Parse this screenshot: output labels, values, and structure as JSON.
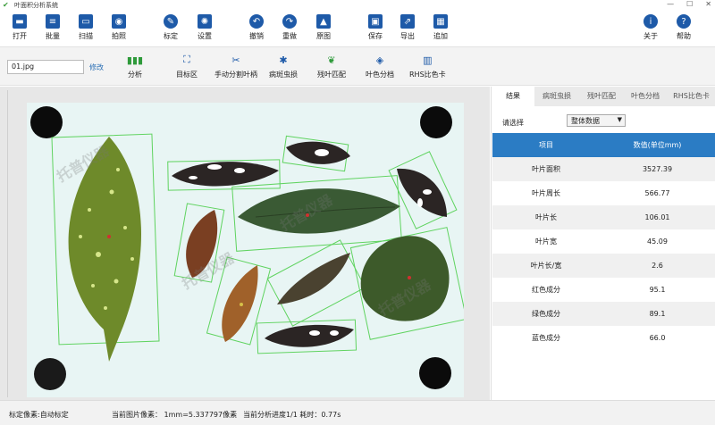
{
  "window": {
    "title": "叶面积分析系统"
  },
  "toolbar": [
    {
      "label": "打开",
      "icon": "folder-open-icon",
      "color": "#1e5aa8"
    },
    {
      "label": "批量",
      "icon": "batch-icon",
      "color": "#1e5aa8"
    },
    {
      "label": "扫描",
      "icon": "scanner-icon",
      "color": "#1e5aa8"
    },
    {
      "label": "拍照",
      "icon": "camera-icon",
      "color": "#1e5aa8"
    },
    {
      "label": "标定",
      "icon": "calibrate-icon",
      "color": "#1e5aa8"
    },
    {
      "label": "设置",
      "icon": "gear-icon",
      "color": "#1e5aa8"
    },
    {
      "label": "撤销",
      "icon": "undo-icon",
      "color": "#1e5aa8"
    },
    {
      "label": "重做",
      "icon": "redo-icon",
      "color": "#1e5aa8"
    },
    {
      "label": "原图",
      "icon": "image-icon",
      "color": "#1e5aa8"
    },
    {
      "label": "保存",
      "icon": "save-icon",
      "color": "#1e5aa8"
    },
    {
      "label": "导出",
      "icon": "export-icon",
      "color": "#1e5aa8"
    },
    {
      "label": "追加",
      "icon": "append-icon",
      "color": "#1e5aa8"
    },
    {
      "label": "关于",
      "icon": "info-icon",
      "color": "#1e5aa8"
    },
    {
      "label": "帮助",
      "icon": "help-icon",
      "color": "#1e5aa8"
    }
  ],
  "file": {
    "name": "01.jpg",
    "edit_label": "修改"
  },
  "tools": [
    {
      "label": "分析",
      "icon": "bar-chart-icon",
      "color": "#2e9a3a"
    },
    {
      "label": "目标区",
      "icon": "target-area-icon",
      "color": "#1e5aa8"
    },
    {
      "label": "手动分割叶柄",
      "icon": "cut-petiole-icon",
      "color": "#1e5aa8"
    },
    {
      "label": "病斑虫损",
      "icon": "bug-icon",
      "color": "#1e5aa8"
    },
    {
      "label": "残叶匹配",
      "icon": "leaf-match-icon",
      "color": "#2e9a3a"
    },
    {
      "label": "叶色分档",
      "icon": "layers-icon",
      "color": "#1e5aa8"
    },
    {
      "label": "RHS比色卡",
      "icon": "color-card-icon",
      "color": "#1e5aa8"
    }
  ],
  "tabs": [
    "结果",
    "病斑虫损",
    "残叶匹配",
    "叶色分档",
    "RHS比色卡"
  ],
  "select": {
    "label": "请选择",
    "value": "整体数据"
  },
  "table": {
    "headers": [
      "项目",
      "数值(单位mm)"
    ],
    "rows": [
      [
        "叶片面积",
        "3527.39"
      ],
      [
        "叶片周长",
        "566.77"
      ],
      [
        "叶片长",
        "106.01"
      ],
      [
        "叶片宽",
        "45.09"
      ],
      [
        "叶片长/宽",
        "2.6"
      ],
      [
        "红色成分",
        "95.1"
      ],
      [
        "绿色成分",
        "89.1"
      ],
      [
        "蓝色成分",
        "66.0"
      ]
    ]
  },
  "status": {
    "calibration": "标定像素:自动标定",
    "pixel": "当前图片像素： 1mm=5.337797像素",
    "progress": "当前分析进度1/1 耗时：0.77s"
  },
  "watermark": "托普仪器",
  "colors": {
    "accent": "#2b7cc4",
    "box": "#5fd35f",
    "leaf_dark": "#3d5a2a"
  }
}
